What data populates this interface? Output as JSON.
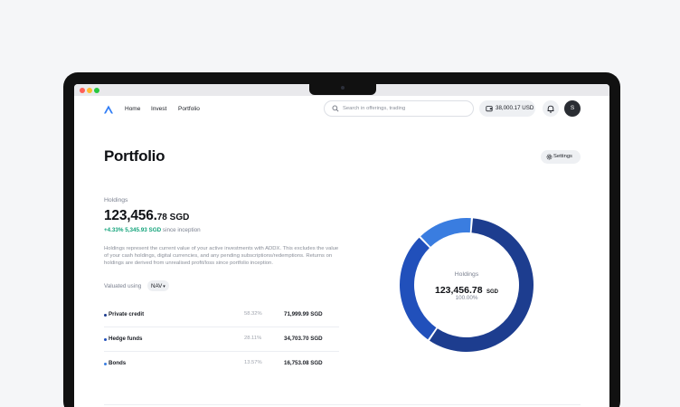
{
  "nav": {
    "links": [
      "Home",
      "Invest",
      "Portfolio"
    ],
    "search_placeholder": "Search in offerings, trading",
    "balance": "38,000.17 USD",
    "avatar_initial": "S",
    "logo_icon": "adx-logo-icon"
  },
  "page": {
    "title": "Portfolio",
    "settings_label": "Settings"
  },
  "holdings": {
    "label": "Holdings",
    "amount_int": "123,456.",
    "amount_dec": "78 SGD",
    "gain_value": "+4.33% 5,345.93 SGD",
    "gain_suffix": " since inception",
    "description": "Holdings represent the current value of your active investments with ADDX. This excludes the value of your cash holdings, digital currencies, and any pending subscriptions/redemptions. Returns on holdings are derived from unrealised profit/loss since portfolio inception.",
    "valuated_label": "Valuated using",
    "valuation_method": "NAV"
  },
  "assets": [
    {
      "name": "Private credit",
      "percent": "58.32%",
      "value": "71,999.99 SGD",
      "share": 0.5832,
      "color": "#1d3d8f"
    },
    {
      "name": "Hedge funds",
      "percent": "28.11%",
      "value": "34,703.70 SGD",
      "share": 0.2811,
      "color": "#2150bb"
    },
    {
      "name": "Bonds",
      "percent": "13.57%",
      "value": "16,753.08 SGD",
      "share": 0.1357,
      "color": "#3a7de0"
    }
  ],
  "donut": {
    "label": "Holdings",
    "amount_num": "123,456.78",
    "amount_cur": "SGD",
    "percent": "100.00%"
  }
}
